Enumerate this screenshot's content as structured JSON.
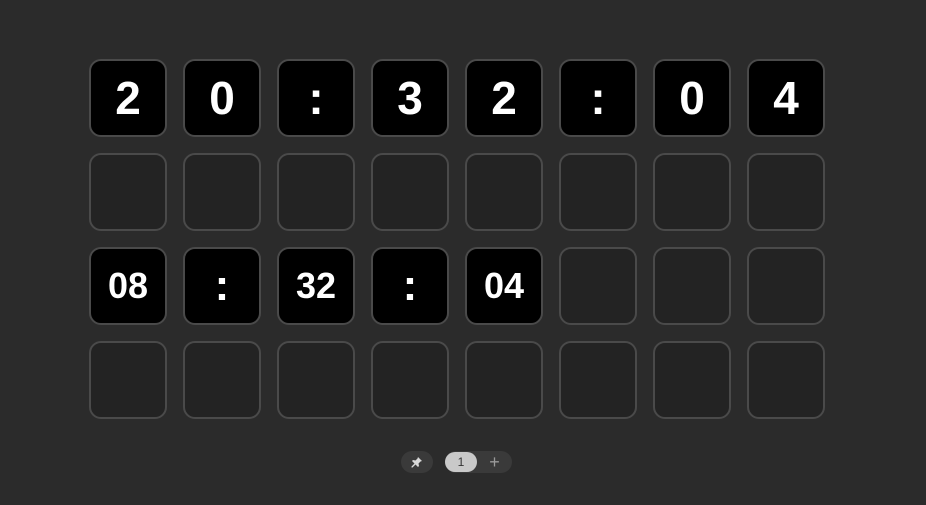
{
  "clock": {
    "digits_row": [
      "2",
      "0",
      ":",
      "3",
      "2",
      ":",
      "0",
      "4"
    ],
    "compact_row": [
      "08",
      ":",
      "32",
      ":",
      "04"
    ]
  },
  "pager": {
    "current_page": "1",
    "add_label": "+",
    "pin_icon": "pin-icon"
  }
}
